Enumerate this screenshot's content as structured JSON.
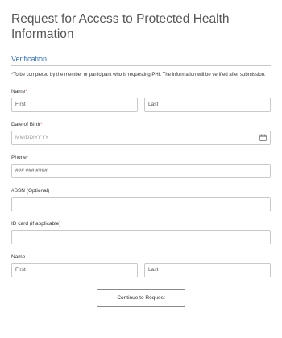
{
  "form": {
    "title": "Request for Access to Protected Health Information",
    "section_title": "Verification",
    "note": "*To be completed by the member or participant who is requesting PHI. The information will be verified after submission.",
    "required_mark": "*",
    "name": {
      "label": "Name",
      "first": "First",
      "last": "Last"
    },
    "dob": {
      "label": "Date of Birth",
      "placeholder": "MM/DD/YYYY"
    },
    "phone": {
      "label": "Phone",
      "value": "### ### ####"
    },
    "ssn": {
      "label": "#SSN (Optional)",
      "value": ""
    },
    "id_card": {
      "label": "ID card (if applicable)",
      "value": ""
    },
    "name2": {
      "label": "Name",
      "first": "First",
      "last": "Last"
    },
    "continue_label": "Continue to Request"
  },
  "colors": {
    "accent": "#2f6fb5",
    "required": "#c0392b",
    "border": "#c9c9c9"
  },
  "icons": {
    "dob": "calendar-icon"
  }
}
